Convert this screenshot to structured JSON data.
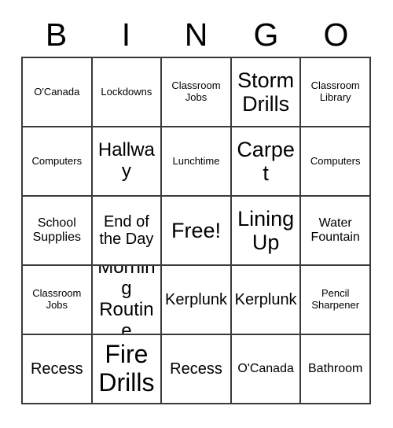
{
  "card": {
    "title_letters": [
      "B",
      "I",
      "N",
      "G",
      "O"
    ],
    "border_color": "#3a3a3a",
    "text_color": "#000000",
    "background_color": "#ffffff",
    "rows": 5,
    "columns": 5
  },
  "grid": {
    "row1": [
      {
        "text": "O'Canada",
        "size": "sm"
      },
      {
        "text": "Lockdowns",
        "size": "sm"
      },
      {
        "text": "Classroom Jobs",
        "size": "sm"
      },
      {
        "text": "Storm Drills",
        "size": "xxl"
      },
      {
        "text": "Classroom Library",
        "size": "sm"
      }
    ],
    "row2": [
      {
        "text": "Computers",
        "size": "sm"
      },
      {
        "text": "Hallway",
        "size": "xl"
      },
      {
        "text": "Lunchtime",
        "size": "sm"
      },
      {
        "text": "Carpet",
        "size": "xxl"
      },
      {
        "text": "Computers",
        "size": "sm"
      }
    ],
    "row3": [
      {
        "text": "School Supplies",
        "size": "md"
      },
      {
        "text": "End of the Day",
        "size": "lg"
      },
      {
        "text": "Free!",
        "size": "xxl"
      },
      {
        "text": "Lining Up",
        "size": "xxl"
      },
      {
        "text": "Water Fountain",
        "size": "md"
      }
    ],
    "row4": [
      {
        "text": "Classroom Jobs",
        "size": "sm"
      },
      {
        "text": "Morning Routine",
        "size": "xl"
      },
      {
        "text": "Kerplunk",
        "size": "lg"
      },
      {
        "text": "Kerplunk",
        "size": "lg"
      },
      {
        "text": "Pencil Sharpener",
        "size": "sm"
      }
    ],
    "row5": [
      {
        "text": "Recess",
        "size": "lg"
      },
      {
        "text": "Fire Drills",
        "size": "huge"
      },
      {
        "text": "Recess",
        "size": "lg"
      },
      {
        "text": "O'Canada",
        "size": "md"
      },
      {
        "text": "Bathroom",
        "size": "md"
      }
    ]
  }
}
